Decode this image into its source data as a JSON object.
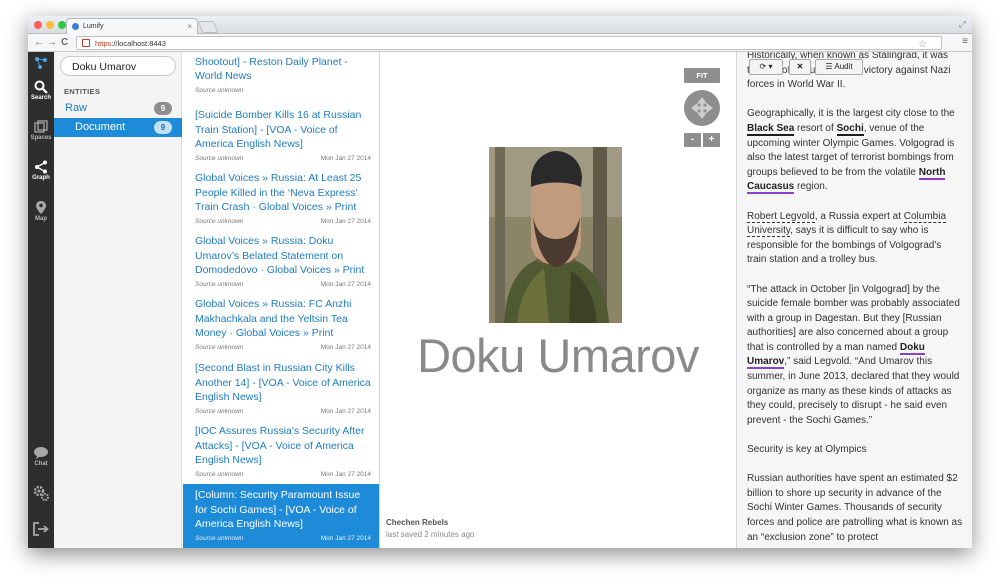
{
  "browser": {
    "tab_title": "Lumify",
    "tab_close": "×",
    "url_scheme": "https",
    "url_rest": "://localhost:8443",
    "nav_back": "←",
    "nav_forward": "→",
    "nav_reload": "C"
  },
  "rail": {
    "items": [
      {
        "label": "Search",
        "icon": "search-icon"
      },
      {
        "label": "Spaces",
        "icon": "spaces-icon"
      },
      {
        "label": "Graph",
        "icon": "graph-icon"
      },
      {
        "label": "Map",
        "icon": "map-pin-icon"
      },
      {
        "label": "Chat",
        "icon": "chat-icon"
      }
    ]
  },
  "search": {
    "query": "Doku Umarov",
    "entities_heading": "ENTITIES",
    "concepts": [
      {
        "label": "Raw",
        "count": "9"
      },
      {
        "label": "Document",
        "count": "9"
      }
    ]
  },
  "results": [
    {
      "title": "[Russian Police Kill Militant in Shootout] - Reston Daily Planet - World News",
      "source": "Source unknown",
      "date": ""
    },
    {
      "title": "[Suicide Bomber Kills 16 at Russian Train Station] - [VOA - Voice of America English News]",
      "source": "Source unknown",
      "date": "Mon Jan 27 2014"
    },
    {
      "title": "Global Voices » Russia: At Least 25 People Killed in the ‘Neva Express’ Train Crash · Global Voices » Print",
      "source": "Source unknown",
      "date": "Mon Jan 27 2014"
    },
    {
      "title": "Global Voices » Russia: Doku Umarov’s Belated Statement on Domodedovo · Global Voices » Print",
      "source": "Source unknown",
      "date": "Mon Jan 27 2014"
    },
    {
      "title": "Global Voices » Russia: FC Anzhi Makhachkala and the Yeltsin Tea Money · Global Voices » Print",
      "source": "Source unknown",
      "date": "Mon Jan 27 2014"
    },
    {
      "title": "[Second Blast in Russian City Kills Another 14] - [VOA - Voice of America English News]",
      "source": "Source unknown",
      "date": "Mon Jan 27 2014"
    },
    {
      "title": "[IOC Assures Russia's Security After Attacks] - [VOA - Voice of America English News]",
      "source": "Source unknown",
      "date": "Mon Jan 27 2014"
    },
    {
      "title": "[Column: Security Paramount Issue for Sochi Games] - [VOA - Voice of America English News]",
      "source": "Source unknown",
      "date": "Mon Jan 27 2014"
    }
  ],
  "graph": {
    "fit_label": "FIT",
    "zoom_out": "-",
    "zoom_in": "+",
    "node_label": "Doku Umarov",
    "case_name": "Chechen Rebels",
    "saved_status": "last saved 2 minutes ago"
  },
  "detail": {
    "toolbar": {
      "audit_label": "Audit"
    },
    "p0": "Historically, when known as Stalingrad, it was the site of a crucial Soviet victory against Nazi forces in World War II.",
    "p1_a": "Geographically, it is the largest city close to the ",
    "p1_black_sea": "Black Sea",
    "p1_b": " resort of ",
    "p1_sochi": "Sochi",
    "p1_c": ", venue of the upcoming winter Olympic Games. Volgograd is also the latest target of terrorist bombings from groups believed to be from the volatile ",
    "p1_north_caucasus": "North Caucasus",
    "p1_d": " region.",
    "p2_legvold": "Robert Legvold",
    "p2_a": ", a Russia expert at ",
    "p2_columbia": "Columbia University",
    "p2_b": ", says it is difficult to say who is responsible for the bombings of Volgograd's train station and a trolley bus.",
    "p3_a": "“The attack in October [in Volgograd] by the suicide female bomber was probably associated with a group in Dagestan. But they [Russian authorities] are also concerned about a group that is controlled by a man named ",
    "p3_umarov": "Doku Umarov",
    "p3_b": ",” said Legvold. “And Umarov this summer, in June 2013, declared that they would organize as many as these kinds of attacks as they could, precisely to disrupt - he said even prevent - the Sochi Games.”",
    "p4": "Security is key at Olympics",
    "p5": "Russian authorities have spent an estimated $2 billion to shore up security in advance of the Sochi Winter Games. Thousands of security forces and police are patrolling what is known as an “exclusion zone” to protect"
  }
}
